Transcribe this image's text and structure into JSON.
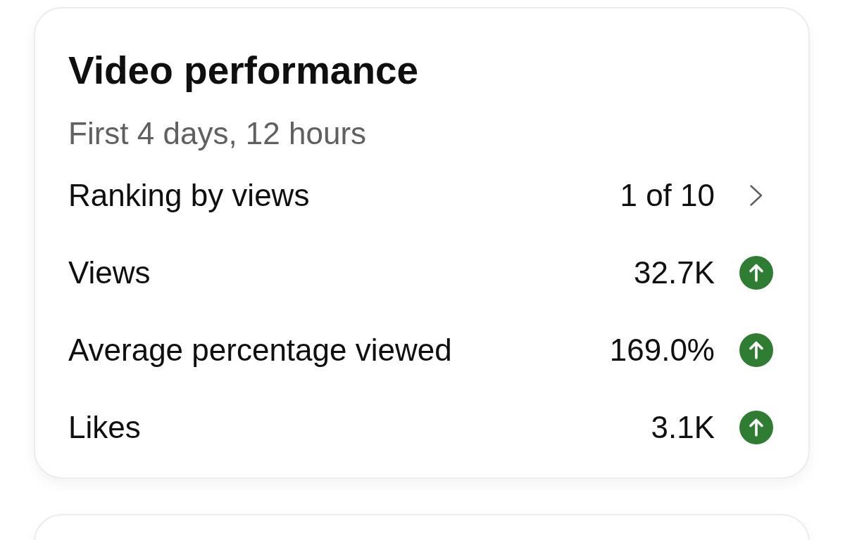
{
  "card": {
    "title": "Video performance",
    "subtitle": "First 4 days, 12 hours",
    "rows": [
      {
        "kind": "link",
        "label": "Ranking by views",
        "value": "1 of 10"
      },
      {
        "kind": "trend",
        "label": "Views",
        "value": "32.7K",
        "increase": true
      },
      {
        "kind": "trend",
        "label": "Average percentage viewed",
        "value": "169.0%",
        "increase": true
      },
      {
        "kind": "trend",
        "label": "Likes",
        "value": "3.1K",
        "increase": true
      }
    ]
  }
}
